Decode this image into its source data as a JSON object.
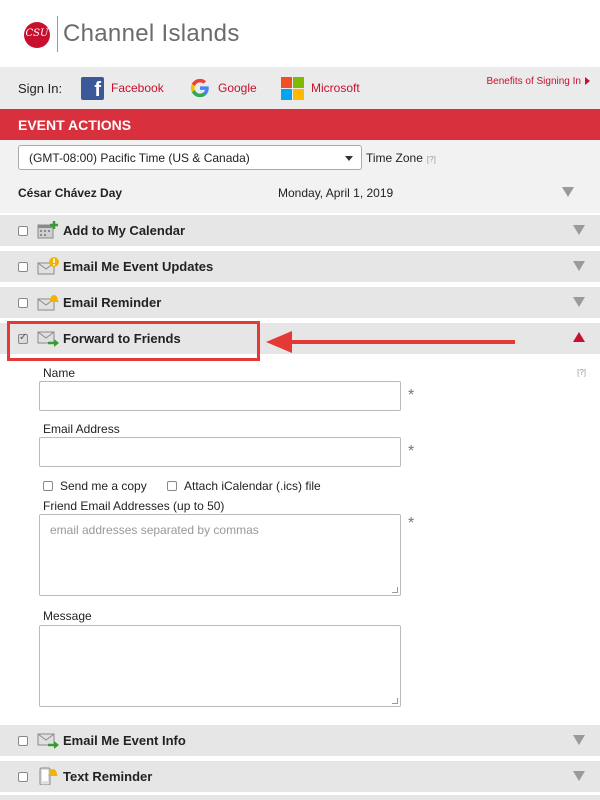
{
  "header": {
    "logo_mark": "CSU",
    "brand": "Channel Islands"
  },
  "signin": {
    "label": "Sign In:",
    "providers": [
      {
        "name": "Facebook",
        "icon": "facebook-icon"
      },
      {
        "name": "Google",
        "icon": "google-icon"
      },
      {
        "name": "Microsoft",
        "icon": "microsoft-icon"
      }
    ],
    "benefits": "Benefits of Signing In"
  },
  "event_actions": {
    "title": "EVENT ACTIONS",
    "timezone": {
      "value": "(GMT-08:00) Pacific Time (US & Canada)",
      "label": "Time Zone",
      "help": "[?]"
    },
    "event": {
      "name": "César Chávez Day",
      "date": "Monday, April 1, 2019"
    },
    "actions": [
      {
        "label": "Add to My Calendar",
        "checked": false,
        "icon": "calendar-add-icon"
      },
      {
        "label": "Email Me Event Updates",
        "checked": false,
        "icon": "email-alert-icon"
      },
      {
        "label": "Email Reminder",
        "checked": false,
        "icon": "email-bell-icon"
      },
      {
        "label": "Forward to Friends",
        "checked": true,
        "icon": "email-forward-icon"
      },
      {
        "label": "Email Me Event Info",
        "checked": false,
        "icon": "email-info-icon"
      },
      {
        "label": "Text Reminder",
        "checked": false,
        "icon": "phone-bell-icon"
      }
    ]
  },
  "forward_form": {
    "help": "[?]",
    "name_label": "Name",
    "name_value": "",
    "email_label": "Email Address",
    "email_value": "",
    "required_mark": "*",
    "send_copy_label": "Send me a copy",
    "attach_ics_label": "Attach iCalendar (.ics) file",
    "friends_label": "Friend Email Addresses (up to 50)",
    "friends_placeholder": "email addresses separated by commas",
    "message_label": "Message",
    "message_value": ""
  },
  "annotation": {
    "color": "#e53935"
  },
  "colors": {
    "brand_red": "#c8102e",
    "header_bar": "#d9303d"
  }
}
